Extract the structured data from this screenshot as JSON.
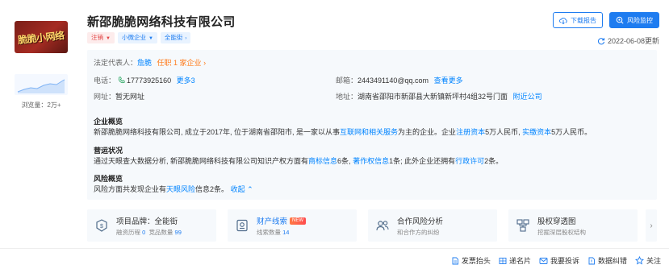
{
  "company": {
    "name": "新邵脆脆网络科技有限公司",
    "logo_text": "脆脆小网络",
    "views_label": "浏览量：2万+",
    "tags": [
      {
        "label": "注销",
        "style": "red",
        "has_caret": true
      },
      {
        "label": "小微企业",
        "style": "blue",
        "has_caret": true
      },
      {
        "label": "全能街",
        "style": "blue",
        "has_caret": true
      }
    ]
  },
  "header": {
    "download_label": "下载报告",
    "monitor_label": "风险监控",
    "updated": "2022-06-08更新"
  },
  "info": {
    "legal_rep_label": "法定代表人：",
    "legal_rep_name": "詹脆",
    "legal_rep_role": "任职 1 家企业",
    "phone_label": "电话：",
    "phone_value": "17773925160",
    "phone_more": "更多3",
    "email_label": "邮箱：",
    "email_value": "2443491140@qq.com",
    "email_more": "查看更多",
    "website_label": "网址：",
    "website_value": "暂无网址",
    "address_label": "地址：",
    "address_value": "湖南省邵阳市新邵县大新镇新坪村4组32号门面",
    "address_nearby": "附近公司"
  },
  "overview": {
    "title": "企业概览",
    "p1": "新邵脆脆网络科技有限公司, 成立于2017年, 位于湖南省邵阳市, 是一家以从事",
    "p1_link": "互联网和相关服务",
    "p2": "为主的企业。企业",
    "p2_link": "注册资本",
    "p3": "5万人民币,",
    "p3_link": "实缴资本",
    "p4": "5万人民币。"
  },
  "operation": {
    "title": "营运状况",
    "p1": "通过天眼查大数据分析, 新邵脆脆网络科技有限公司知识产权方面有",
    "l1": "商标信息",
    "p2": "6条,",
    "l2": "著作权信息",
    "p3": "1条; 此外企业还拥有",
    "l3": "行政许可",
    "p4": "2条。"
  },
  "risk": {
    "title": "风险概览",
    "p1": "风险方面共发现企业有",
    "l1": "天眼风险",
    "p2": "信息2条。",
    "collapse": "收起"
  },
  "cards": [
    {
      "title": "项目品牌：全能街",
      "sub1": "融资历程",
      "n1": "0",
      "sub2": "竞品数量",
      "n2": "99",
      "new": false,
      "icon": "brand-icon"
    },
    {
      "title": "财产线索",
      "sub1": "线索数量",
      "n1": "14",
      "sub2": "",
      "n2": "",
      "new": true,
      "new_label": "NEW",
      "icon": "property-icon"
    },
    {
      "title": "合作风险分析",
      "sub1": "和合作方的纠纷",
      "n1": "",
      "sub2": "",
      "n2": "",
      "new": false,
      "icon": "cooperation-icon"
    },
    {
      "title": "股权穿透图",
      "sub1": "挖掘深层股权结构",
      "n1": "",
      "sub2": "",
      "n2": "",
      "new": false,
      "icon": "equity-icon"
    }
  ],
  "footer_actions": [
    {
      "label": "发票抬头",
      "icon": "invoice-icon"
    },
    {
      "label": "递名片",
      "icon": "card-icon"
    },
    {
      "label": "我要投诉",
      "icon": "complaint-icon"
    },
    {
      "label": "数据纠错",
      "icon": "error-report-icon"
    },
    {
      "label": "关注",
      "icon": "star-icon"
    }
  ],
  "colors": {
    "accent": "#1e7cf0",
    "link": "#0084ff",
    "panel": "#f6f9fc",
    "danger": "#e14242"
  }
}
